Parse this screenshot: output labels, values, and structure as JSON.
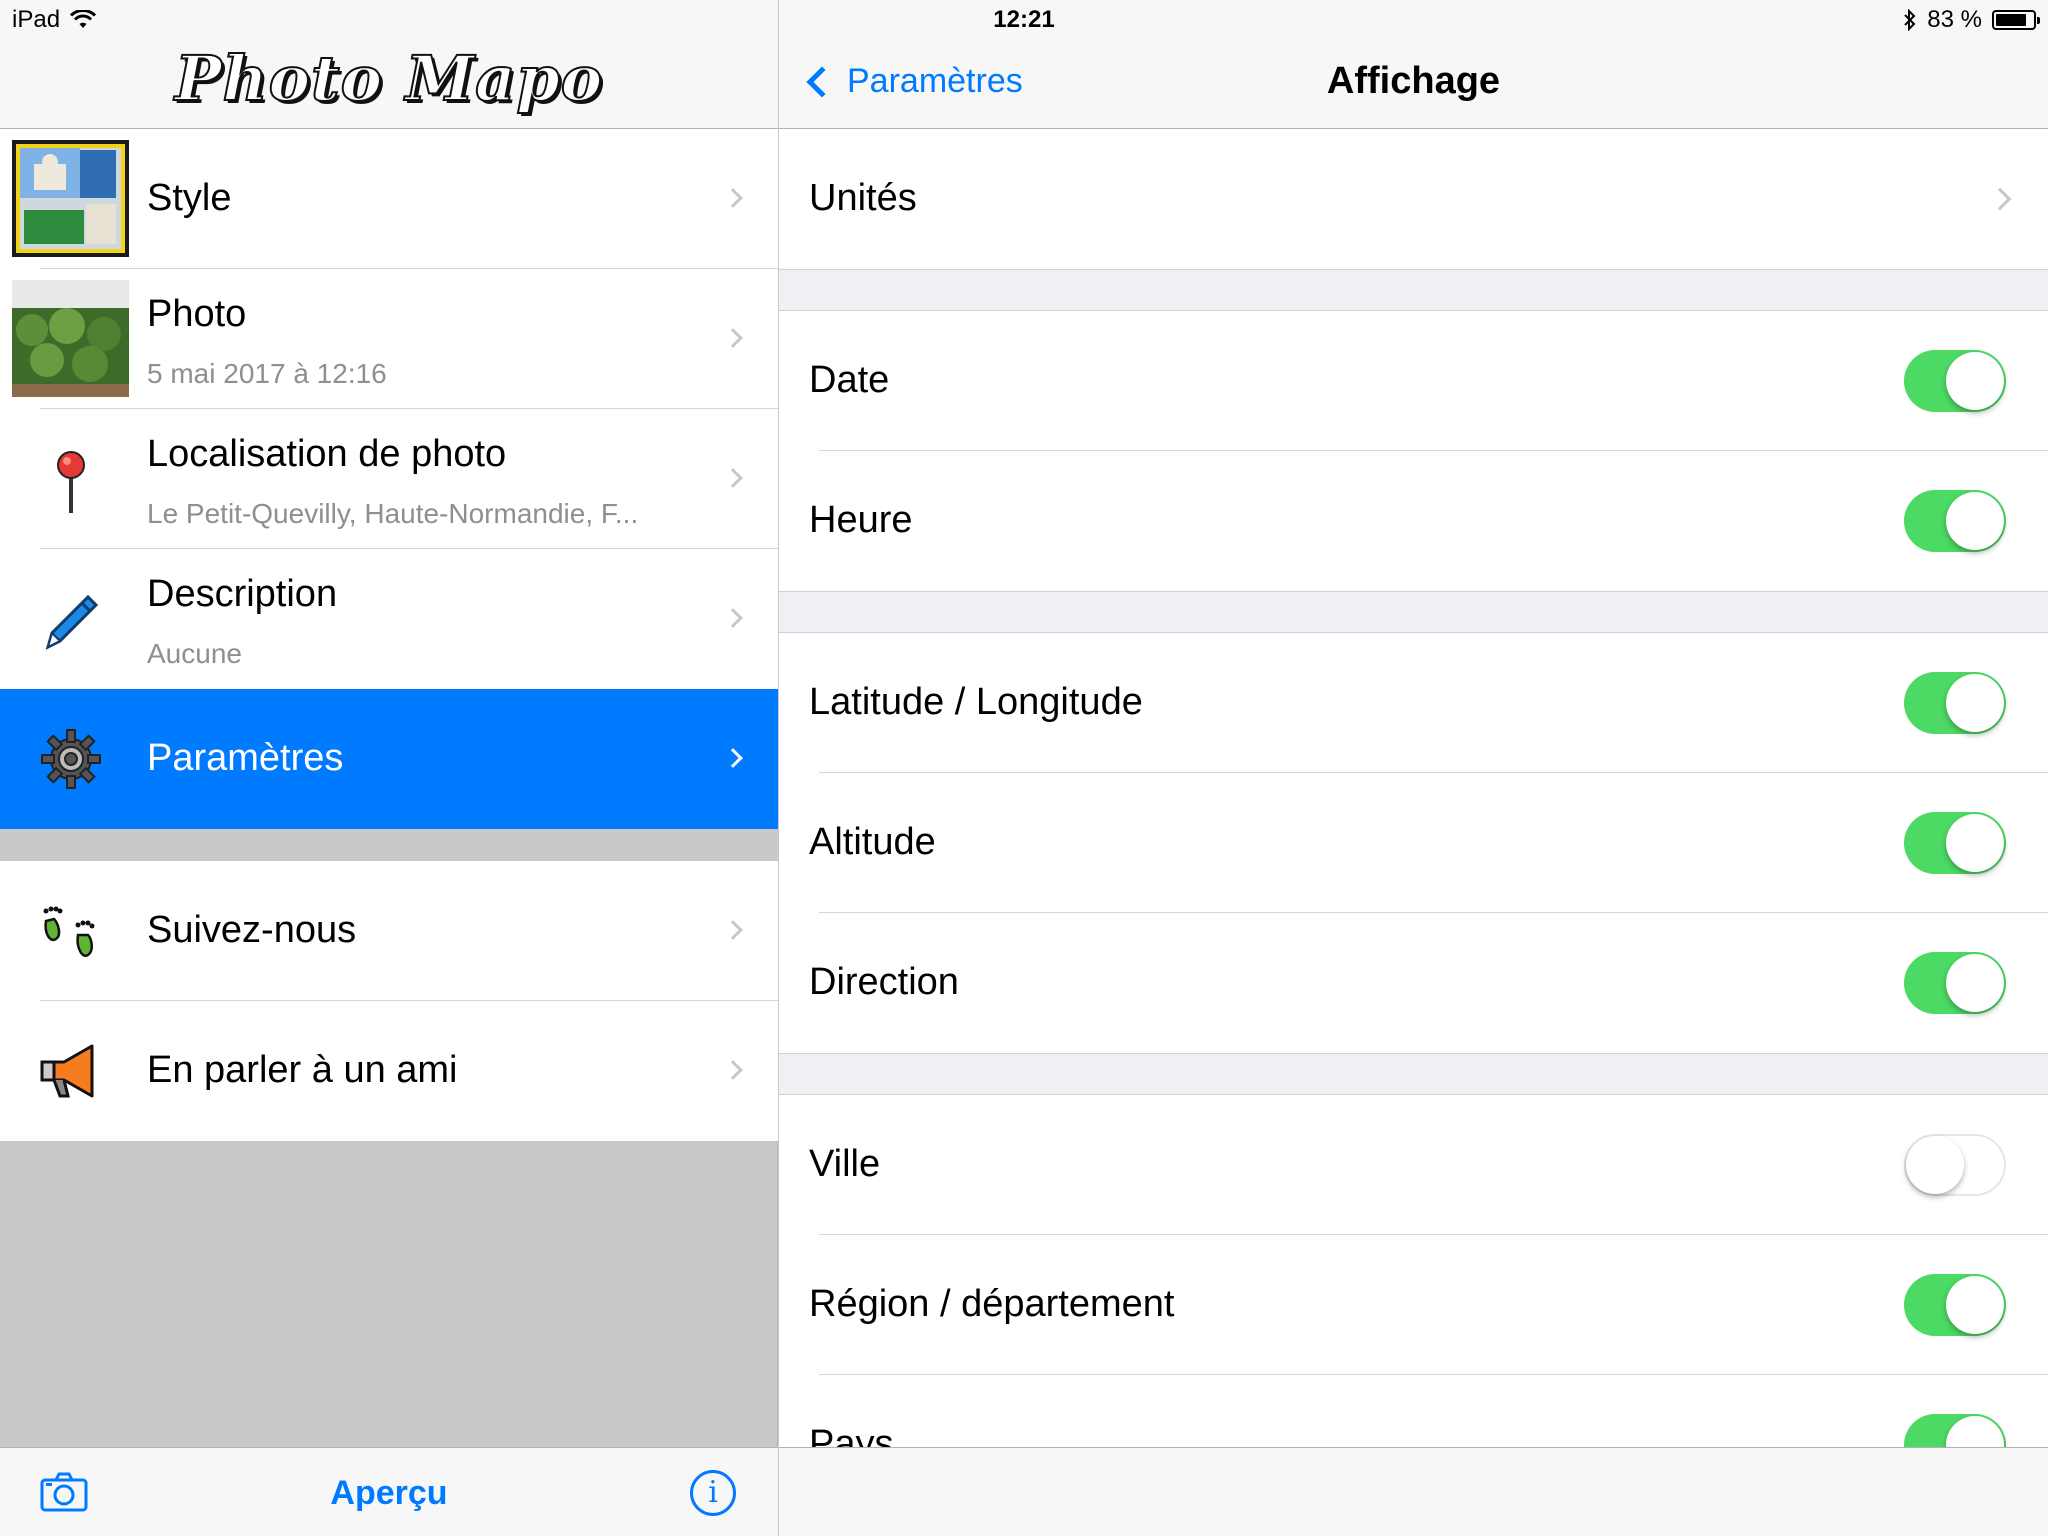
{
  "status": {
    "device": "iPad",
    "time": "12:21",
    "battery": "83 %",
    "battery_level": 0.83
  },
  "left": {
    "logo": "Photo Mapo",
    "items": [
      {
        "title": "Style",
        "subtitle": ""
      },
      {
        "title": "Photo",
        "subtitle": "5 mai 2017 à 12:16"
      },
      {
        "title": "Localisation de photo",
        "subtitle": "Le Petit-Quevilly, Haute-Normandie, F..."
      },
      {
        "title": "Description",
        "subtitle": "Aucune"
      },
      {
        "title": "Paramètres",
        "subtitle": ""
      },
      {
        "title": "Suivez-nous",
        "subtitle": ""
      },
      {
        "title": "En parler à un ami",
        "subtitle": ""
      }
    ],
    "tab_title": "Aperçu"
  },
  "right": {
    "back_label": "Paramètres",
    "title": "Affichage",
    "rows": {
      "units": "Unités",
      "date": {
        "label": "Date",
        "on": true
      },
      "time": {
        "label": "Heure",
        "on": true
      },
      "latlon": {
        "label": "Latitude / Longitude",
        "on": true
      },
      "altitude": {
        "label": "Altitude",
        "on": true
      },
      "direction": {
        "label": "Direction",
        "on": true
      },
      "city": {
        "label": "Ville",
        "on": false
      },
      "region": {
        "label": "Région / département",
        "on": true
      },
      "country": {
        "label": "Pays",
        "on": true
      }
    }
  },
  "colors": {
    "accent": "#007aff",
    "toggle_on": "#4cd964",
    "selected_row": "#007aff"
  }
}
